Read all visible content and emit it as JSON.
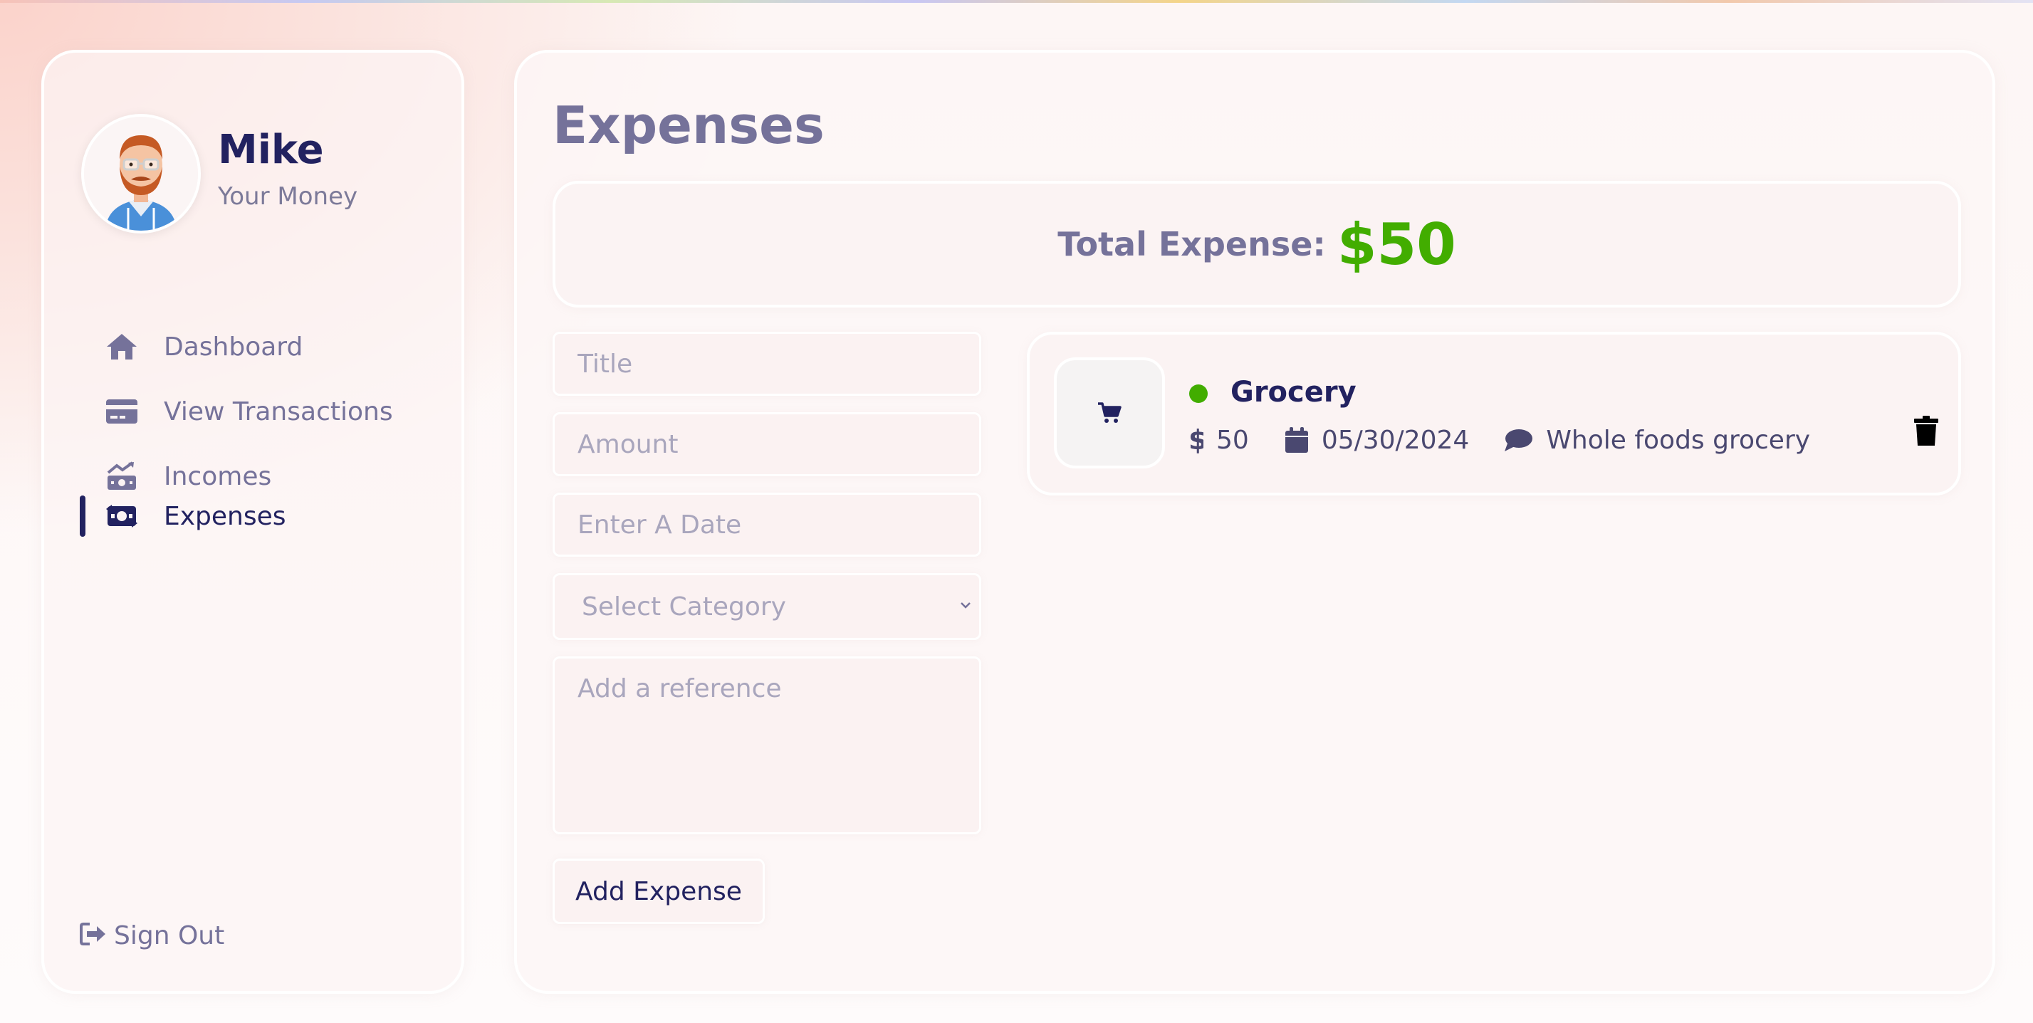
{
  "user": {
    "name": "Mike",
    "subtitle": "Your Money"
  },
  "nav": {
    "items": [
      {
        "label": "Dashboard",
        "icon": "home-icon",
        "active": false
      },
      {
        "label": "View Transactions",
        "icon": "credit-card-icon",
        "active": false
      },
      {
        "label": "Incomes",
        "icon": "money-trend-icon",
        "active": false
      },
      {
        "label": "Expenses",
        "icon": "money-exchange-icon",
        "active": true
      }
    ],
    "signout_label": "Sign Out"
  },
  "page": {
    "title": "Expenses",
    "total_label": "Total Expense:",
    "total_value": "$50"
  },
  "form": {
    "title_placeholder": "Title",
    "amount_placeholder": "Amount",
    "date_placeholder": "Enter A Date",
    "category_placeholder": "Select Category",
    "reference_placeholder": "Add a reference",
    "submit_label": "Add Expense"
  },
  "expenses": [
    {
      "title": "Grocery",
      "amount": "50",
      "date": "05/30/2024",
      "description": "Whole foods grocery",
      "icon": "shopping-cart-icon",
      "status_color": "#42ad00"
    }
  ],
  "colors": {
    "primary": "#222260",
    "muted": "#75729a",
    "accent_green": "#42ad00"
  }
}
